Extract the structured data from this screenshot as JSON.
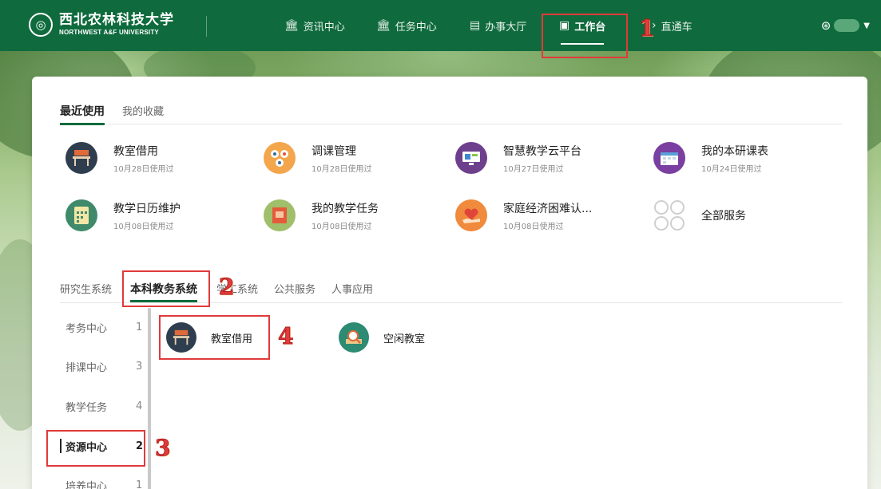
{
  "university": {
    "name_cn": "西北农林科技大学",
    "name_en": "NORTHWEST A&F UNIVERSITY",
    "emblem_icon": "university-emblem-icon"
  },
  "nav": {
    "items": [
      {
        "label": "资讯中心",
        "icon": "building-icon"
      },
      {
        "label": "任务中心",
        "icon": "building-icon"
      },
      {
        "label": "办事大厅",
        "icon": "document-icon"
      },
      {
        "label": "工作台",
        "icon": "workbench-icon",
        "active": true
      },
      {
        "label": "直通车",
        "icon": "arrow-icon"
      }
    ],
    "user_icon": "user-circle-icon"
  },
  "recent": {
    "tabs": [
      "最近使用",
      "我的收藏"
    ],
    "apps": [
      {
        "title": "教室借用",
        "sub": "10月28日使用过",
        "icon": "classroom-desk-icon",
        "color": "#2f3e4e"
      },
      {
        "title": "调课管理",
        "sub": "10月28日使用过",
        "icon": "people-swap-icon",
        "color": "#f3a64c"
      },
      {
        "title": "智慧教学云平台",
        "sub": "10月27日使用过",
        "icon": "cloud-teaching-icon",
        "color": "#6d3f8c"
      },
      {
        "title": "我的本研课表",
        "sub": "10月24日使用过",
        "icon": "calendar-schedule-icon",
        "color": "#7a3fa0"
      },
      {
        "title": "教学日历维护",
        "sub": "10月08日使用过",
        "icon": "calendar-grid-icon",
        "color": "#3e8a6a"
      },
      {
        "title": "我的教学任务",
        "sub": "10月08日使用过",
        "icon": "task-book-icon",
        "color": "#9fbf6a"
      },
      {
        "title": "家庭经济困难认...",
        "sub": "10月08日使用过",
        "icon": "heart-hand-icon",
        "color": "#f08a3c"
      },
      {
        "title": "全部服务",
        "sub": "",
        "icon": "all-services-icon",
        "color": "#ffffff"
      }
    ]
  },
  "categories": {
    "tabs": [
      "研究生系统",
      "本科教务系统",
      "学工系统",
      "公共服务",
      "人事应用"
    ],
    "active_index": 1,
    "side_items": [
      {
        "label": "考务中心",
        "count": "1"
      },
      {
        "label": "排课中心",
        "count": "3"
      },
      {
        "label": "教学任务",
        "count": "4"
      },
      {
        "label": "资源中心",
        "count": "2",
        "active": true
      },
      {
        "label": "培养中心",
        "count": "1"
      }
    ],
    "apps": [
      {
        "title": "教室借用",
        "icon": "classroom-desk-icon",
        "color": "#2f3e4e"
      },
      {
        "title": "空闲教室",
        "icon": "magnifier-room-icon",
        "color": "#2d8a73"
      }
    ]
  },
  "annotations": [
    "1",
    "2",
    "3",
    "4"
  ],
  "colors": {
    "brand": "#0f6b3d",
    "annotation": "#e03a3a"
  }
}
